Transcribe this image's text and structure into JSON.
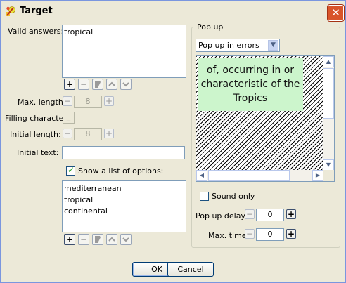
{
  "window": {
    "title": "Target",
    "close_glyph": "✕"
  },
  "left": {
    "valid_answers_label": "Valid answers:",
    "valid_answers": [
      "tropical"
    ],
    "max_length_label": "Max. length:",
    "max_length_value": "8",
    "filling_char_label": "Filling character",
    "filling_char_value": "_",
    "initial_length_label": "Initial length:",
    "initial_length_value": "8",
    "initial_text_label": "Initial text:",
    "initial_text_value": "",
    "show_list_label": "Show a list of options:",
    "show_list_checked": true,
    "options": [
      "mediterranean",
      "tropical",
      "continental"
    ]
  },
  "toolbar_icons": {
    "add": "+",
    "remove": "−",
    "edit": "edit-icon",
    "up": "up-arrow-icon",
    "down": "down-arrow-icon"
  },
  "popup": {
    "group_label": "Pop up",
    "mode_selected": "Pop up in errors",
    "tooltip_text": "of, occurring in or characteristic of the Tropics",
    "tooltip_color": "#ccf5cc",
    "sound_only_label": "Sound only",
    "sound_only_checked": false,
    "delay_label": "Pop up delay:",
    "delay_value": "0",
    "max_time_label": "Max. time:",
    "max_time_value": "0"
  },
  "buttons": {
    "ok": "OK",
    "cancel": "Cancel"
  },
  "colors": {
    "title_close": "#d9552a",
    "panel_bg": "#ece9d8",
    "border": "#7f9db9"
  }
}
